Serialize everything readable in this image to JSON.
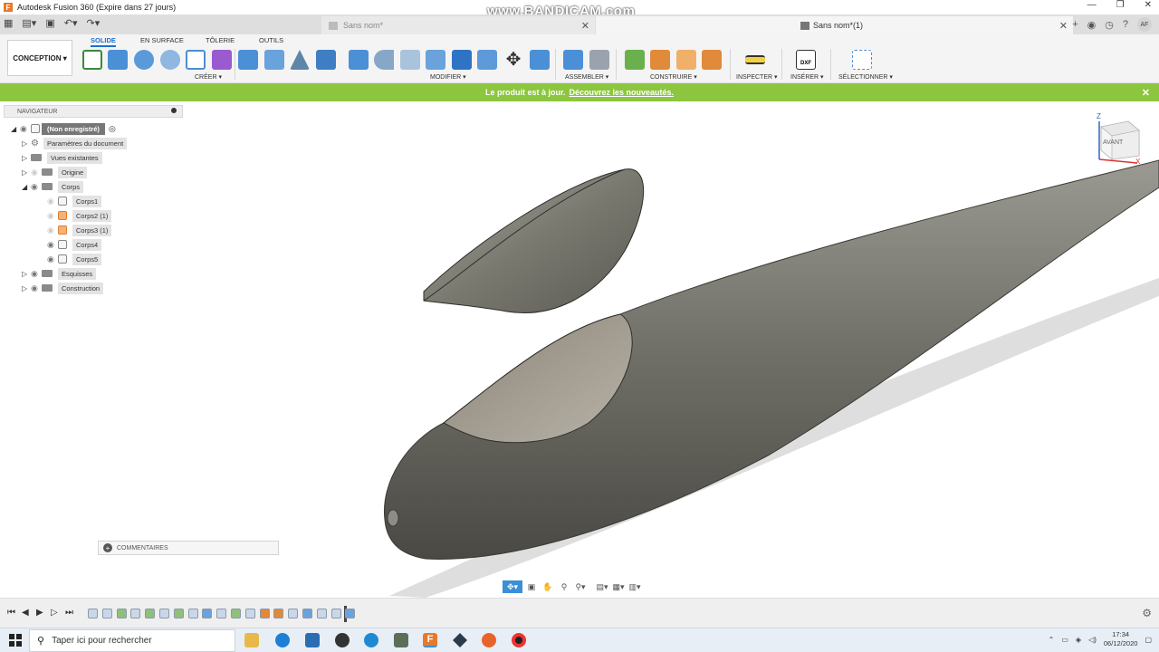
{
  "window": {
    "title": "Autodesk Fusion 360 (Expire dans 27 jours)",
    "controls": [
      "—",
      "❐",
      "✕"
    ]
  },
  "watermark": "www.BANDICAM.com",
  "tabs": [
    {
      "label": "Sans nom*"
    },
    {
      "label": "Sans nom*(1)"
    }
  ],
  "user": {
    "initials": "AF"
  },
  "ribbon": {
    "workspace": "CONCEPTION ▾",
    "tabs": [
      "SOLIDE",
      "EN SURFACE",
      "TÔLERIE",
      "OUTILS"
    ],
    "groups": [
      "CRÉER ▾",
      "MODIFIER ▾",
      "ASSEMBLER ▾",
      "CONSTRUIRE ▾",
      "INSPECTER ▾",
      "INSÉRER ▾",
      "SÉLECTIONNER ▾"
    ],
    "dxf_badge": "DXF"
  },
  "banner": {
    "text": "Le produit est à jour.",
    "link": "Découvrez les nouveautés."
  },
  "navigator": {
    "title": "NAVIGATEUR",
    "root": "(Non enregistré)",
    "items": [
      {
        "label": "Paramètres du document"
      },
      {
        "label": "Vues existantes"
      },
      {
        "label": "Origine"
      },
      {
        "label": "Corps"
      },
      {
        "label": "Corps1"
      },
      {
        "label": "Corps2 (1)"
      },
      {
        "label": "Corps3 (1)"
      },
      {
        "label": "Corps4"
      },
      {
        "label": "Corps5"
      },
      {
        "label": "Esquisses"
      },
      {
        "label": "Construction"
      }
    ]
  },
  "viewcube": {
    "face": "AVANT",
    "z_axis": "Z",
    "x_axis": "X"
  },
  "comments": {
    "label": "COMMENTAIRES"
  },
  "taskbar": {
    "search_placeholder": "Taper ici pour rechercher",
    "time": "17:34",
    "date": "06/12/2020"
  }
}
